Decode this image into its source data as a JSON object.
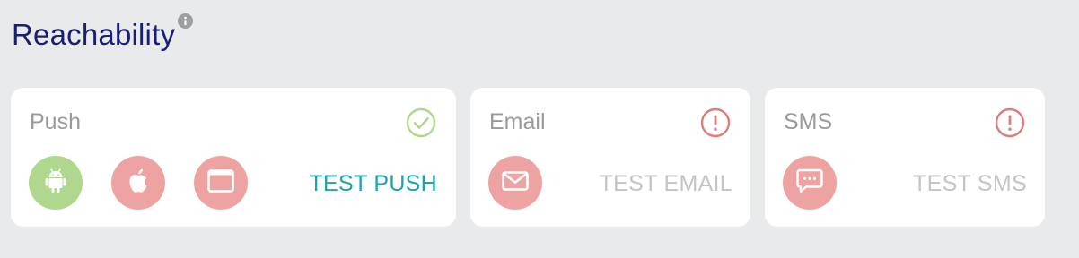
{
  "header": {
    "title": "Reachability",
    "info_icon": "info-icon"
  },
  "colors": {
    "title": "#1a1f6e",
    "ok": "#afd88e",
    "error": "#eea3a3",
    "accent": "#1aa3b0",
    "disabled": "#c4c4c4"
  },
  "cards": [
    {
      "label": "Push",
      "status": "ok",
      "status_icon": "check-circle-icon",
      "platforms": [
        {
          "icon": "android-icon",
          "status": "ok"
        },
        {
          "icon": "apple-icon",
          "status": "error"
        },
        {
          "icon": "browser-window-icon",
          "status": "error"
        }
      ],
      "test_label": "TEST PUSH",
      "test_enabled": true
    },
    {
      "label": "Email",
      "status": "error",
      "status_icon": "alert-circle-icon",
      "platforms": [
        {
          "icon": "envelope-icon",
          "status": "error"
        }
      ],
      "test_label": "TEST EMAIL",
      "test_enabled": false
    },
    {
      "label": "SMS",
      "status": "error",
      "status_icon": "alert-circle-icon",
      "platforms": [
        {
          "icon": "chat-bubble-icon",
          "status": "error"
        }
      ],
      "test_label": "TEST SMS",
      "test_enabled": false
    }
  ]
}
